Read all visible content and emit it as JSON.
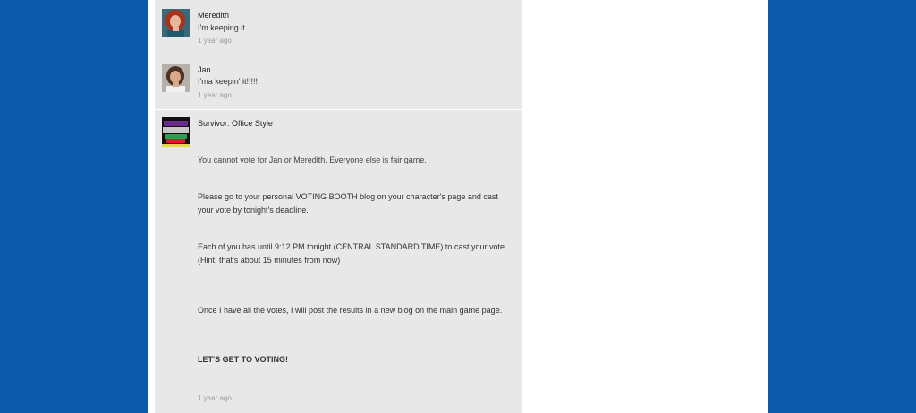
{
  "posts": [
    {
      "author": "Meredith",
      "message": "I'm keeping it.",
      "time": "1 year ago",
      "avatar_icon": "avatar-redhead-woman"
    },
    {
      "author": "Jan",
      "message": "I'ma keepin' it!!!!!",
      "time": "1 year ago",
      "avatar_icon": "avatar-dark-haired-woman"
    },
    {
      "author": "Survivor: Office Style",
      "avatar_icon": "survivor-logo",
      "paragraphs": {
        "rule": "You cannot vote for Jan or Meredith.  Everyone else is fair game.",
        "p1_line1": "Please go to your personal VOTING BOOTH blog on your character's page and cast",
        "p1_line2": "your vote by tonight's deadline.",
        "p2_line1": "Each of you has until 9:12 PM tonight (CENTRAL STANDARD TIME) to cast your vote.",
        "p2_line2": "(Hint:  that's about 15 minutes from now)",
        "p3": "Once I have all the votes, I will post the results in a new blog on the main game page.",
        "p4": "LET'S GET TO VOTING!"
      },
      "time": "1 year ago"
    }
  ],
  "colors": {
    "background": "#0b59a8",
    "feed": "#e8e8e8"
  }
}
